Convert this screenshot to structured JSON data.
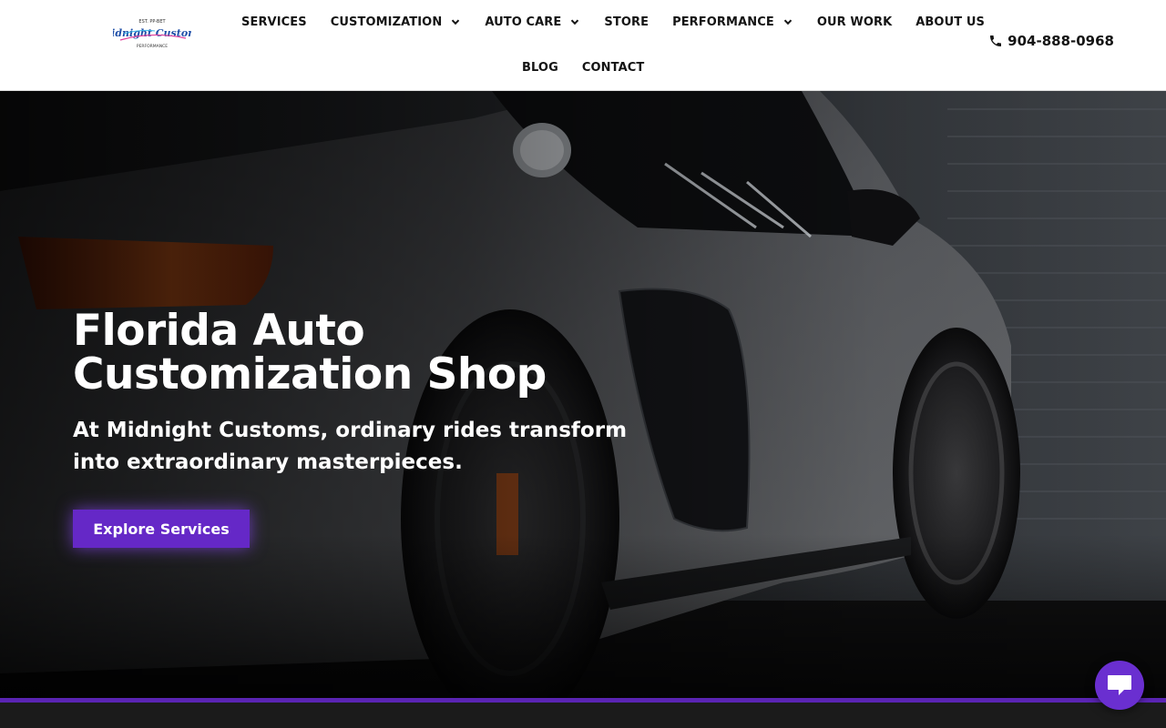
{
  "logo": {
    "icon": "midnight-customs-logo",
    "text": "Midnight Customs",
    "tagline_top": "EST. PP-BET",
    "tagline_bottom": "PERFORMANCE"
  },
  "nav": {
    "row1": [
      {
        "label": "SERVICES",
        "dropdown": false
      },
      {
        "label": "CUSTOMIZATION",
        "dropdown": true
      },
      {
        "label": "AUTO CARE",
        "dropdown": true
      },
      {
        "label": "STORE",
        "dropdown": false
      },
      {
        "label": "PERFORMANCE",
        "dropdown": true
      },
      {
        "label": "OUR WORK",
        "dropdown": false
      },
      {
        "label": "ABOUT US",
        "dropdown": false
      }
    ],
    "row2": [
      {
        "label": "BLOG",
        "dropdown": false
      },
      {
        "label": "CONTACT",
        "dropdown": false
      }
    ]
  },
  "phone": {
    "icon": "phone-icon",
    "number": "904-888-0968"
  },
  "hero": {
    "title_line1": "Florida Auto",
    "title_line2": "Customization Shop",
    "subtitle": "At Midnight Customs, ordinary rides transform into extraordinary masterpieces.",
    "cta_label": "Explore Services"
  },
  "chat": {
    "icon": "chat-bubble-icon"
  },
  "colors": {
    "accent": "#6528c7",
    "header_bg": "#ffffff",
    "text_dark": "#141414",
    "footer_bg": "#1b1b1b"
  }
}
